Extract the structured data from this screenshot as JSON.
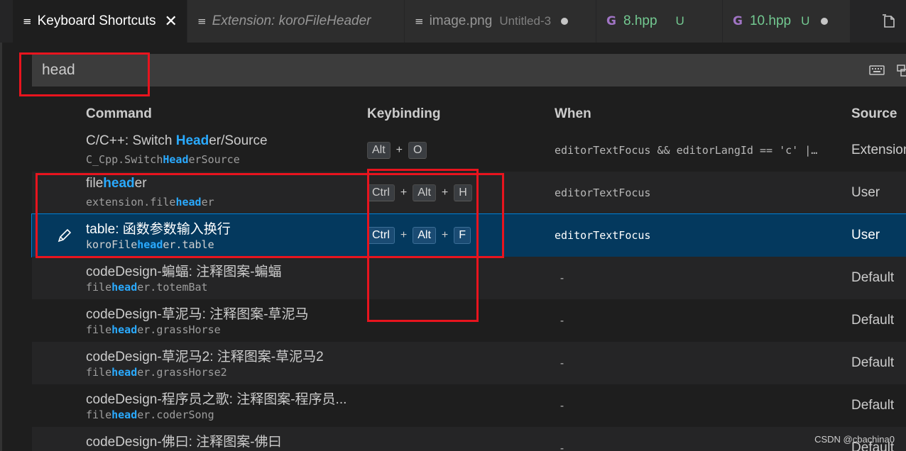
{
  "tabs": [
    {
      "label": "Keyboard Shortcuts",
      "active": true,
      "icon": "list-icon"
    },
    {
      "label": "Extension: koroFileHeader",
      "icon": "list-icon"
    },
    {
      "label": "image.png",
      "desc": "Untitled-3",
      "icon": "list-icon"
    },
    {
      "label": "8.hpp",
      "badge": "U",
      "icon": "cpp-icon"
    },
    {
      "label": "10.hpp",
      "badge": "U",
      "icon": "cpp-icon"
    }
  ],
  "search": {
    "value": "head"
  },
  "columns": {
    "command": "Command",
    "keybinding": "Keybinding",
    "when": "When",
    "source": "Source"
  },
  "rows": [
    {
      "title_pre": "C/C++: Switch ",
      "title_hl": "Head",
      "title_post": "er/Source",
      "id_pre": "C_Cpp.Switch",
      "id_hl": "Head",
      "id_post": "erSource",
      "keys": [
        "Alt",
        "O"
      ],
      "when": "editorTextFocus && editorLangId == 'c' |…",
      "source": "Extension"
    },
    {
      "title_pre": "file",
      "title_hl": "head",
      "title_post": "er",
      "id_pre": "extension.file",
      "id_hl": "head",
      "id_post": "er",
      "keys": [
        "Ctrl",
        "Alt",
        "H"
      ],
      "when": "editorTextFocus",
      "source": "User"
    },
    {
      "title_pre": "table: 函数参数输入换行",
      "title_hl": "",
      "title_post": "",
      "id_pre": "koroFile",
      "id_hl": "head",
      "id_post": "er.table",
      "keys": [
        "Ctrl",
        "Alt",
        "F"
      ],
      "when": "editorTextFocus",
      "source": "User",
      "selected": true
    },
    {
      "title_pre": "codeDesign-蝙蝠: 注释图案-蝙蝠",
      "title_hl": "",
      "title_post": "",
      "id_pre": "file",
      "id_hl": "head",
      "id_post": "er.totemBat",
      "keys": [],
      "when": "-",
      "source": "Default"
    },
    {
      "title_pre": "codeDesign-草泥马: 注释图案-草泥马",
      "title_hl": "",
      "title_post": "",
      "id_pre": "file",
      "id_hl": "head",
      "id_post": "er.grassHorse",
      "keys": [],
      "when": "-",
      "source": "Default"
    },
    {
      "title_pre": "codeDesign-草泥马2: 注释图案-草泥马2",
      "title_hl": "",
      "title_post": "",
      "id_pre": "file",
      "id_hl": "head",
      "id_post": "er.grassHorse2",
      "keys": [],
      "when": "-",
      "source": "Default"
    },
    {
      "title_pre": "codeDesign-程序员之歌: 注释图案-程序员...",
      "title_hl": "",
      "title_post": "",
      "id_pre": "file",
      "id_hl": "head",
      "id_post": "er.coderSong",
      "keys": [],
      "when": "-",
      "source": "Default"
    },
    {
      "title_pre": "codeDesign-佛曰: 注释图案-佛曰",
      "title_hl": "",
      "title_post": "",
      "id_pre": "",
      "id_hl": "",
      "id_post": "",
      "keys": [],
      "when": "-",
      "source": "Default"
    }
  ],
  "watermark": "CSDN @cbachina0",
  "colors": {
    "accent": "#2aaaff",
    "selected_row": "#04395e",
    "annotation": "#e8141e"
  }
}
